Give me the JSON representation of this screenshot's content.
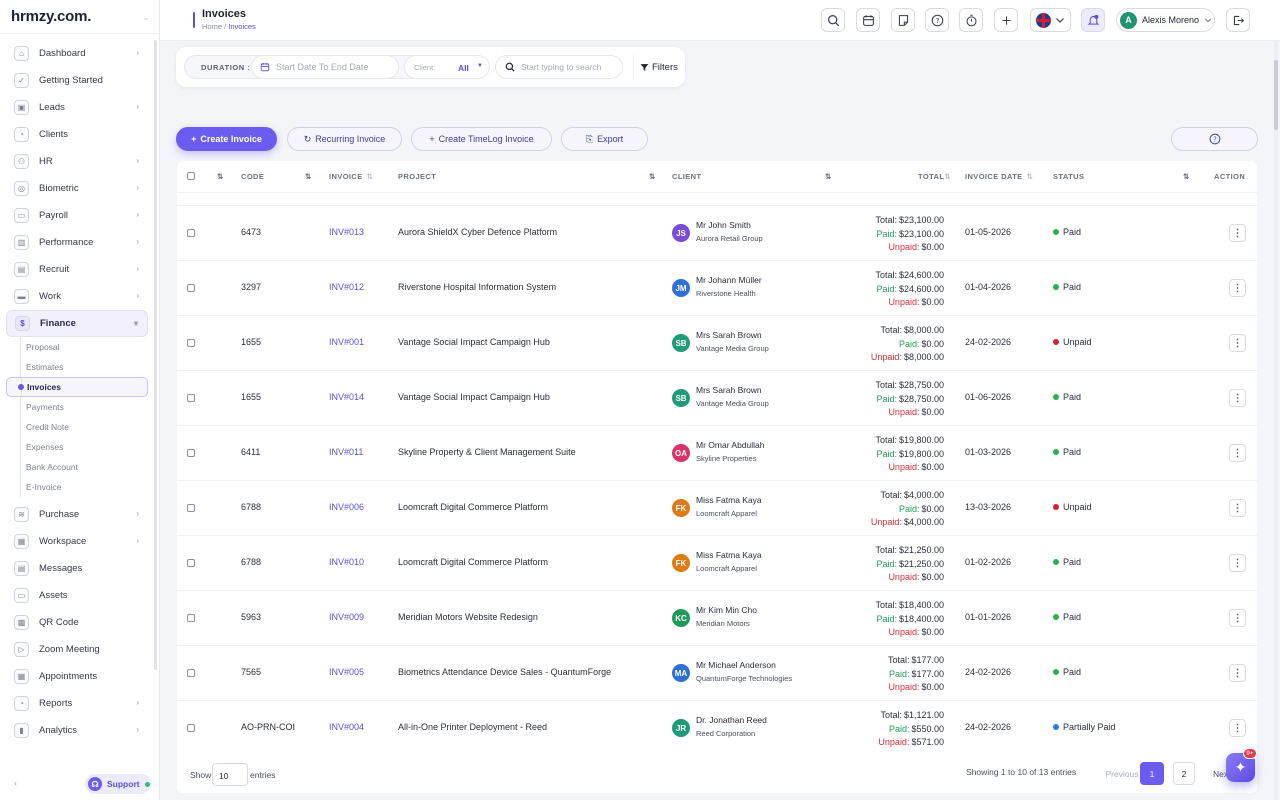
{
  "sidebar": {
    "logo": "hrmzy.com.",
    "items": [
      {
        "label": "Dashboard",
        "icon": "home-icon",
        "glyph": "⌂",
        "arrow": true
      },
      {
        "label": "Getting Started",
        "icon": "check-circle-icon",
        "glyph": "✓",
        "arrow": false
      },
      {
        "label": "Leads",
        "icon": "contact-card-icon",
        "glyph": "▣",
        "arrow": true
      },
      {
        "label": "Clients",
        "icon": "clients-icon",
        "glyph": "◔",
        "arrow": false
      },
      {
        "label": "HR",
        "icon": "people-icon",
        "glyph": "⚇",
        "arrow": true
      },
      {
        "label": "Biometric",
        "icon": "fingerprint-icon",
        "glyph": "◎",
        "arrow": true
      },
      {
        "label": "Payroll",
        "icon": "wallet-icon",
        "glyph": "▭",
        "arrow": true
      },
      {
        "label": "Performance",
        "icon": "bar-chart-icon",
        "glyph": "▥",
        "arrow": true
      },
      {
        "label": "Recruit",
        "icon": "id-badge-icon",
        "glyph": "▤",
        "arrow": true
      },
      {
        "label": "Work",
        "icon": "briefcase-icon",
        "glyph": "▬",
        "arrow": true
      },
      {
        "label": "Finance",
        "icon": "dollar-icon",
        "glyph": "$",
        "arrow": true,
        "active": true
      }
    ],
    "finance_sub": [
      "Proposal",
      "Estimates",
      "Invoices",
      "Payments",
      "Credit Note",
      "Expenses",
      "Bank Account",
      "E-Invoice"
    ],
    "items_after": [
      {
        "label": "Purchase",
        "icon": "stack-icon",
        "glyph": "≋",
        "arrow": true
      },
      {
        "label": "Workspace",
        "icon": "grid-icon",
        "glyph": "▦",
        "arrow": true
      },
      {
        "label": "Messages",
        "icon": "message-icon",
        "glyph": "▤",
        "arrow": false
      },
      {
        "label": "Assets",
        "icon": "monitor-icon",
        "glyph": "▭",
        "arrow": false
      },
      {
        "label": "QR Code",
        "icon": "qr-code-icon",
        "glyph": "▩",
        "arrow": false
      },
      {
        "label": "Zoom Meeting",
        "icon": "video-icon",
        "glyph": "▷",
        "arrow": false
      },
      {
        "label": "Appointments",
        "icon": "calendar-check-icon",
        "glyph": "▦",
        "arrow": false
      },
      {
        "label": "Reports",
        "icon": "chart-pie-icon",
        "glyph": "◔",
        "arrow": true
      },
      {
        "label": "Analytics",
        "icon": "analytics-icon",
        "glyph": "▮",
        "arrow": true
      }
    ],
    "collapse": "‹",
    "support": "Support"
  },
  "header": {
    "title": "Invoices",
    "breadcrumb_home": "Home",
    "breadcrumb_sep": "/",
    "breadcrumb_current": "Invoices",
    "user_initial": "A",
    "user_name": "Alexis Moreno"
  },
  "filters": {
    "duration_label": "DURATION :",
    "date_placeholder": "Start Date To End Date",
    "client_label": "Client:",
    "client_value": "All",
    "search_placeholder": "Start typing to search",
    "filters_label": "Filters"
  },
  "actions": {
    "create": "Create Invoice",
    "recurring": "Recurring Invoice",
    "timelog": "Create TimeLog Invoice",
    "export": "Export"
  },
  "table": {
    "columns": [
      "CODE",
      "INVOICE",
      "PROJECT",
      "CLIENT",
      "TOTAL",
      "INVOICE DATE",
      "STATUS",
      "ACTION"
    ],
    "total_prefix": "Total:",
    "paid_prefix": "Paid:",
    "unpaid_prefix": "Unpaid:",
    "rows": [
      {
        "code": "6473",
        "invoice": "INV#013",
        "project": "Aurora ShieldX Cyber Defence Platform",
        "initials": "JS",
        "avatar_color": "#7a4bd8",
        "client_name": "Mr John Smith",
        "company": "Aurora Retail Group",
        "total": "$23,100.00",
        "paid": "$23,100.00",
        "unpaid": "$0.00",
        "date": "01-05-2026",
        "status": "Paid",
        "status_color": "#2bb04a"
      },
      {
        "code": "3297",
        "invoice": "INV#012",
        "project": "Riverstone Hospital Information System",
        "initials": "JM",
        "avatar_color": "#2f6fd8",
        "client_name": "Mr Johann Müller",
        "company": "Riverstone Health",
        "total": "$24,600.00",
        "paid": "$24,600.00",
        "unpaid": "$0.00",
        "date": "01-04-2026",
        "status": "Paid",
        "status_color": "#2bb04a"
      },
      {
        "code": "1655",
        "invoice": "INV#001",
        "project": "Vantage Social Impact Campaign Hub",
        "initials": "SB",
        "avatar_color": "#1f9a7a",
        "client_name": "Mrs Sarah Brown",
        "company": "Vantage Media Group",
        "total": "$8,000.00",
        "paid": "$0.00",
        "unpaid": "$8,000.00",
        "date": "24-02-2026",
        "status": "Unpaid",
        "status_color": "#d9202f"
      },
      {
        "code": "1655",
        "invoice": "INV#014",
        "project": "Vantage Social Impact Campaign Hub",
        "initials": "SB",
        "avatar_color": "#1f9a7a",
        "client_name": "Mrs Sarah Brown",
        "company": "Vantage Media Group",
        "total": "$28,750.00",
        "paid": "$28,750.00",
        "unpaid": "$0.00",
        "date": "01-06-2026",
        "status": "Paid",
        "status_color": "#2bb04a"
      },
      {
        "code": "6411",
        "invoice": "INV#011",
        "project": "Skyline Property & Client Management Suite",
        "initials": "OA",
        "avatar_color": "#d8336a",
        "client_name": "Mr Omar Abdullah",
        "company": "Skyline Properties",
        "total": "$19,800.00",
        "paid": "$19,800.00",
        "unpaid": "$0.00",
        "date": "01-03-2026",
        "status": "Paid",
        "status_color": "#2bb04a"
      },
      {
        "code": "6788",
        "invoice": "INV#006",
        "project": "Loomcraft Digital Commerce Platform",
        "initials": "FK",
        "avatar_color": "#e07a14",
        "client_name": "Miss Fatma Kaya",
        "company": "Loomcraft Apparel",
        "total": "$4,000.00",
        "paid": "$0.00",
        "unpaid": "$4,000.00",
        "date": "13-03-2026",
        "status": "Unpaid",
        "status_color": "#d9202f"
      },
      {
        "code": "6788",
        "invoice": "INV#010",
        "project": "Loomcraft Digital Commerce Platform",
        "initials": "FK",
        "avatar_color": "#e07a14",
        "client_name": "Miss Fatma Kaya",
        "company": "Loomcraft Apparel",
        "total": "$21,250.00",
        "paid": "$21,250.00",
        "unpaid": "$0.00",
        "date": "01-02-2026",
        "status": "Paid",
        "status_color": "#2bb04a"
      },
      {
        "code": "5963",
        "invoice": "INV#009",
        "project": "Meridian Motors Website Redesign",
        "initials": "KC",
        "avatar_color": "#1f9a5a",
        "client_name": "Mr Kim Min Cho",
        "company": "Meridian Motors",
        "total": "$18,400.00",
        "paid": "$18,400.00",
        "unpaid": "$0.00",
        "date": "01-01-2026",
        "status": "Paid",
        "status_color": "#2bb04a"
      },
      {
        "code": "7565",
        "invoice": "INV#005",
        "project": "Biometrics Attendance Device Sales - QuantumForge",
        "initials": "MA",
        "avatar_color": "#2f6fd8",
        "client_name": "Mr Michael Anderson",
        "company": "QuantumForge Technologies",
        "total": "$177.00",
        "paid": "$177.00",
        "unpaid": "$0.00",
        "date": "24-02-2026",
        "status": "Paid",
        "status_color": "#2bb04a"
      },
      {
        "code": "AO-PRN-COI",
        "invoice": "INV#004",
        "project": "All-in-One Printer Deployment - Reed",
        "initials": "JR",
        "avatar_color": "#1f9a7a",
        "client_name": "Dr. Jonathan Reed",
        "company": "Reed Corporation",
        "total": "$1,121.00",
        "paid": "$550.00",
        "unpaid": "$571.00",
        "date": "24-02-2026",
        "status": "Partially Paid",
        "status_color": "#2b7be0"
      }
    ]
  },
  "footer": {
    "show": "Show",
    "page_size": "10",
    "entries": "entries",
    "showing": "Showing 1 to 10 of 13 entries",
    "previous": "Previous",
    "page1": "1",
    "page2": "2",
    "next": "Next"
  },
  "fab": {
    "badge": "9+"
  }
}
